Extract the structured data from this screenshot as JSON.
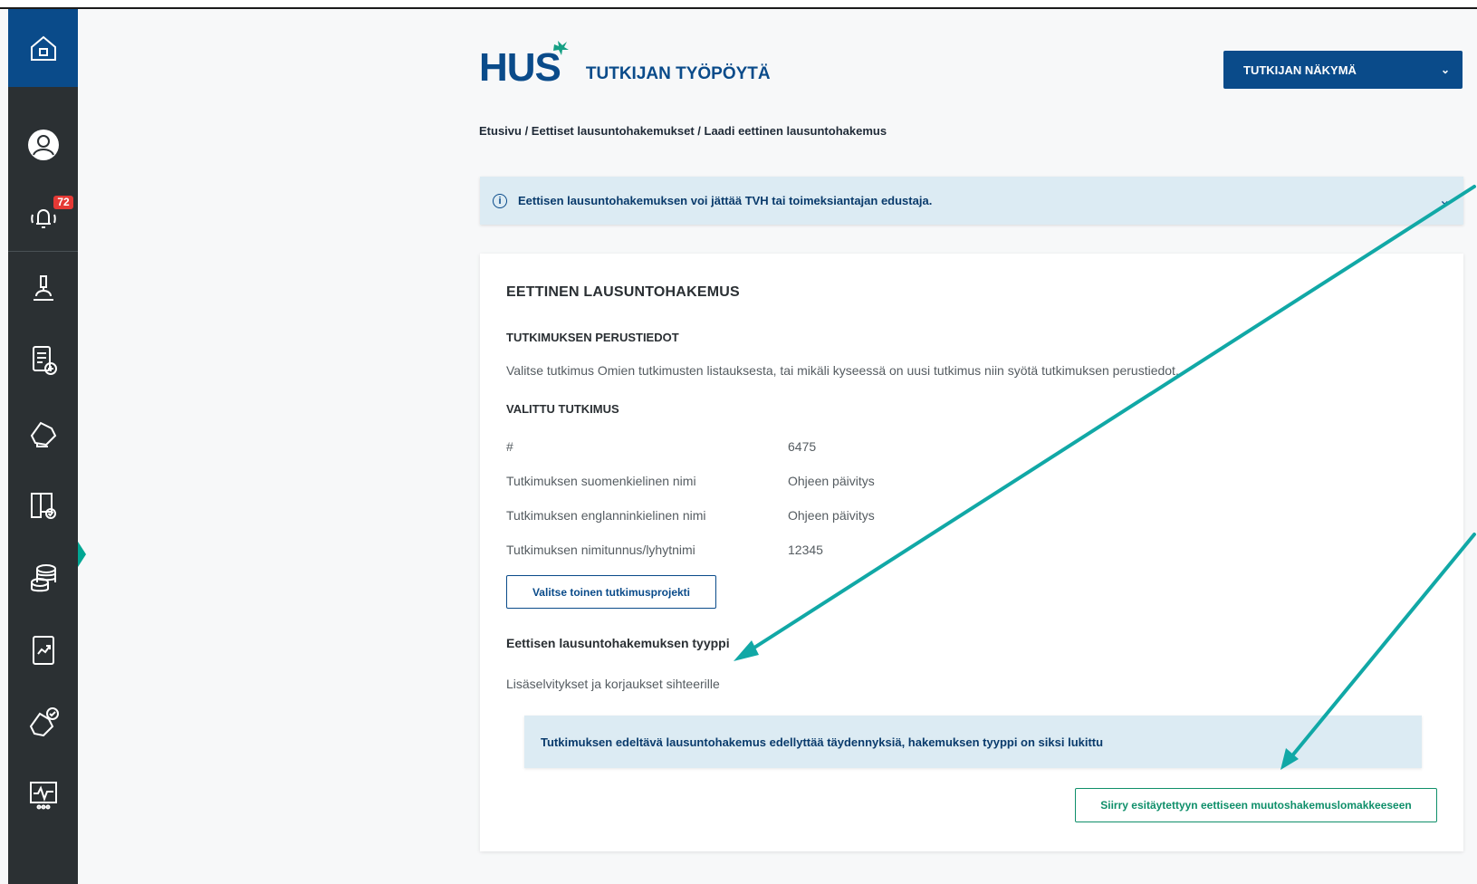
{
  "sidebar": {
    "notification_count": "72",
    "items": [
      {
        "icon": "home-icon"
      },
      {
        "icon": "user-icon"
      },
      {
        "icon": "notification-bell-icon"
      },
      {
        "icon": "microscope-icon"
      },
      {
        "icon": "document-add-icon"
      },
      {
        "icon": "handshake-icon"
      },
      {
        "icon": "archive-check-icon"
      },
      {
        "icon": "coins-stack-icon"
      },
      {
        "icon": "report-chart-icon"
      },
      {
        "icon": "handshake-check-icon"
      },
      {
        "icon": "monitor-pulse-icon"
      }
    ]
  },
  "header": {
    "logo_text": "HUS",
    "app_title": "TUTKIJAN TYÖPÖYTÄ",
    "view_select": "TUTKIJAN NÄKYMÄ"
  },
  "breadcrumb": "Etusivu / Eettiset lausuntohakemukset / Laadi eettinen lausuntohakemus",
  "info_banner": "Eettisen lausuntohakemuksen voi jättää TVH tai toimeksiantajan edustaja.",
  "card": {
    "title": "EETTINEN LAUSUNTOHAKEMUS",
    "basics_title": "TUTKIMUKSEN PERUSTIEDOT",
    "basics_desc": "Valitse tutkimus Omien tutkimusten listauksesta, tai mikäli kyseessä on uusi tutkimus niin syötä tutkimuksen perustiedot.",
    "selected_title": "VALITTU TUTKIMUS",
    "rows": [
      {
        "label": "#",
        "value": "6475"
      },
      {
        "label": "Tutkimuksen suomenkielinen nimi",
        "value": "Ohjeen päivitys"
      },
      {
        "label": "Tutkimuksen englanninkielinen nimi",
        "value": "Ohjeen päivitys"
      },
      {
        "label": "Tutkimuksen nimitunnus/lyhytnimi",
        "value": "12345"
      }
    ],
    "choose_other_button": "Valitse toinen tutkimusprojekti",
    "type_label": "Eettisen lausuntohakemuksen tyyppi",
    "type_value": "Lisäselvitykset ja korjaukset sihteerille",
    "notice": "Tutkimuksen edeltävä lausuntohakemus edellyttää täydennyksiä, hakemuksen tyyppi on siksi lukittu",
    "go_button": "Siirry esitäytettyyn eettiseen muutoshakemuslomakkeeseen"
  },
  "colors": {
    "brand_blue": "#0a4b8a",
    "sidebar_bg": "#2b3033",
    "annotation_teal": "#11a8a6",
    "success_green": "#0f8f6a"
  }
}
